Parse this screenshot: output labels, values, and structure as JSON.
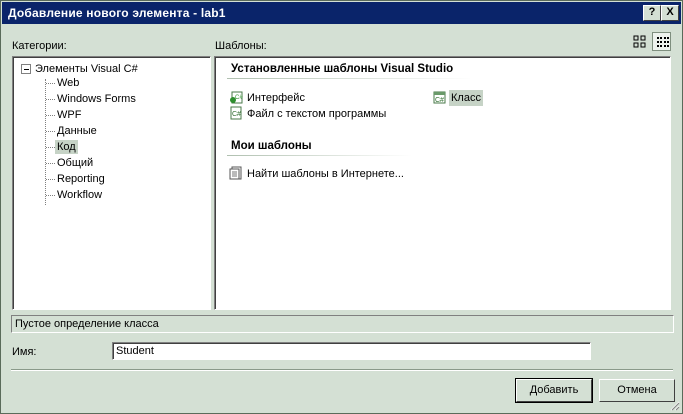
{
  "window": {
    "title": "Добавление нового элемента - lab1",
    "help_button": "?",
    "close_button": "X"
  },
  "categories": {
    "label": "Категории:",
    "root": "Элементы Visual C#",
    "items": [
      "Web",
      "Windows Forms",
      "WPF",
      "Данные",
      "Код",
      "Общий",
      "Reporting",
      "Workflow"
    ],
    "selected": "Код"
  },
  "templates": {
    "label": "Шаблоны:",
    "installed_header": "Установленные шаблоны Visual Studio",
    "installed": [
      {
        "label": "Интерфейс",
        "icon": "csharp-interface-icon"
      },
      {
        "label": "Класс",
        "icon": "csharp-class-icon"
      },
      {
        "label": "Файл с текстом программы",
        "icon": "csharp-file-icon"
      }
    ],
    "selected": "Класс",
    "my_header": "Мои шаблоны",
    "my": [
      {
        "label": "Найти шаблоны в Интернете...",
        "icon": "search-online-icon"
      }
    ]
  },
  "description": "Пустое определение класса",
  "name_field": {
    "label": "Имя:",
    "value": "Student"
  },
  "buttons": {
    "add": "Добавить",
    "cancel": "Отмена"
  },
  "colors": {
    "title_bar": "#0a246a",
    "dialog_bg": "#d4e0d4",
    "selection": "#c6d3c6"
  }
}
